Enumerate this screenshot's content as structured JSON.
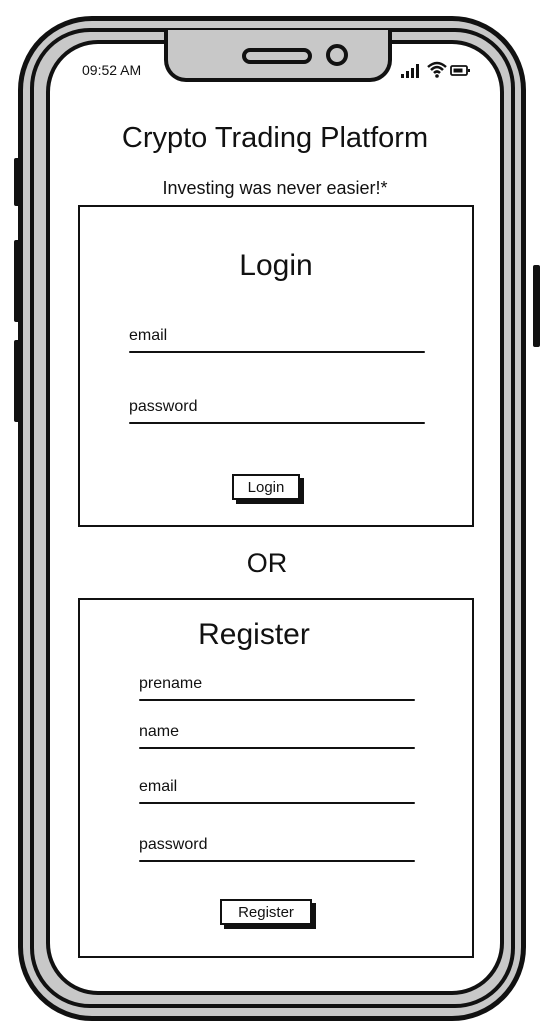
{
  "status_bar": {
    "time": "09:52 AM",
    "icons": [
      "signal-icon",
      "wifi-icon",
      "battery-icon"
    ]
  },
  "app": {
    "title": "Crypto Trading Platform",
    "subtitle": "Investing was never easier!*"
  },
  "login": {
    "title": "Login",
    "email_label": "email",
    "password_label": "password",
    "button_label": "Login"
  },
  "separator": "OR",
  "register": {
    "title": "Register",
    "prename_label": "prename",
    "name_label": "name",
    "email_label": "email",
    "password_label": "password",
    "button_label": "Register"
  }
}
